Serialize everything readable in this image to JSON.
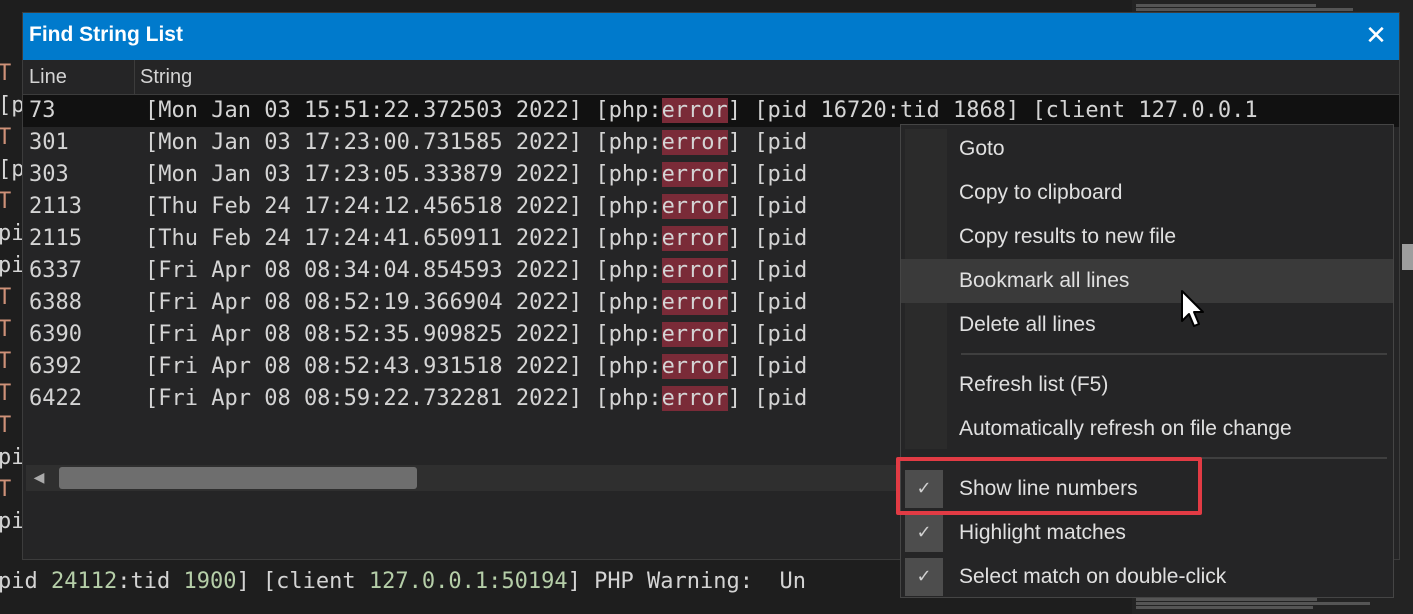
{
  "dialog": {
    "title": "Find String List",
    "close_glyph": "✕",
    "columns": {
      "line": "Line",
      "string": "String"
    },
    "rows": [
      {
        "line": "73",
        "pre": "[Mon Jan 03 15:51:22.372503 2022] [php:",
        "match": "error",
        "post": "] [pid 16720:tid 1868] [client 127.0.0.1"
      },
      {
        "line": "301",
        "pre": "[Mon Jan 03 17:23:00.731585 2022] [php:",
        "match": "error",
        "post": "] [pid"
      },
      {
        "line": "303",
        "pre": "[Mon Jan 03 17:23:05.333879 2022] [php:",
        "match": "error",
        "post": "] [pid"
      },
      {
        "line": "2113",
        "pre": "[Thu Feb 24 17:24:12.456518 2022] [php:",
        "match": "error",
        "post": "] [pid"
      },
      {
        "line": "2115",
        "pre": "[Thu Feb 24 17:24:41.650911 2022] [php:",
        "match": "error",
        "post": "] [pid"
      },
      {
        "line": "6337",
        "pre": "[Fri Apr 08 08:34:04.854593 2022] [php:",
        "match": "error",
        "post": "] [pid"
      },
      {
        "line": "6388",
        "pre": "[Fri Apr 08 08:52:19.366904 2022] [php:",
        "match": "error",
        "post": "] [pid"
      },
      {
        "line": "6390",
        "pre": "[Fri Apr 08 08:52:35.909825 2022] [php:",
        "match": "error",
        "post": "] [pid"
      },
      {
        "line": "6392",
        "pre": "[Fri Apr 08 08:52:43.931518 2022] [php:",
        "match": "error",
        "post": "] [pid"
      },
      {
        "line": "6422",
        "pre": "[Fri Apr 08 08:59:22.732281 2022] [php:",
        "match": "error",
        "post": "] [pid"
      }
    ],
    "selected_row": 0,
    "highlight_color": "#7a2b38",
    "title_bar_color": "#007acc"
  },
  "context_menu": {
    "items": [
      {
        "label": "Goto",
        "checked": false
      },
      {
        "label": "Copy to clipboard",
        "checked": false
      },
      {
        "label": "Copy results to new file",
        "checked": false
      },
      {
        "label": "Bookmark all lines",
        "checked": false,
        "hover": true
      },
      {
        "label": "Delete all lines",
        "checked": false
      },
      {
        "label": "Refresh list (F5)",
        "checked": false
      },
      {
        "label": "Automatically refresh on file change",
        "checked": false
      },
      {
        "label": "Show line numbers",
        "checked": true,
        "annotated": true
      },
      {
        "label": "Highlight matches",
        "checked": true
      },
      {
        "label": "Select match on double-click",
        "checked": true
      }
    ],
    "check_glyph": "✓",
    "annotation_color": "#e23b44"
  },
  "background_editor": {
    "visible_lines": [
      {
        "text_a": "pid ",
        "num_a": "24112",
        "text_b": ":tid ",
        "num_b": "1900",
        "text_c": "] [client ",
        "num_c": "127.0.0.1:50194",
        "text_d": "] PHP Warning:  Un"
      }
    ],
    "gutter_fragments": [
      "T",
      "[p",
      "T",
      "[p",
      "T",
      "pi",
      "pi",
      "T",
      "T",
      "T",
      "T",
      "T",
      "pi",
      "T",
      "pi"
    ]
  }
}
